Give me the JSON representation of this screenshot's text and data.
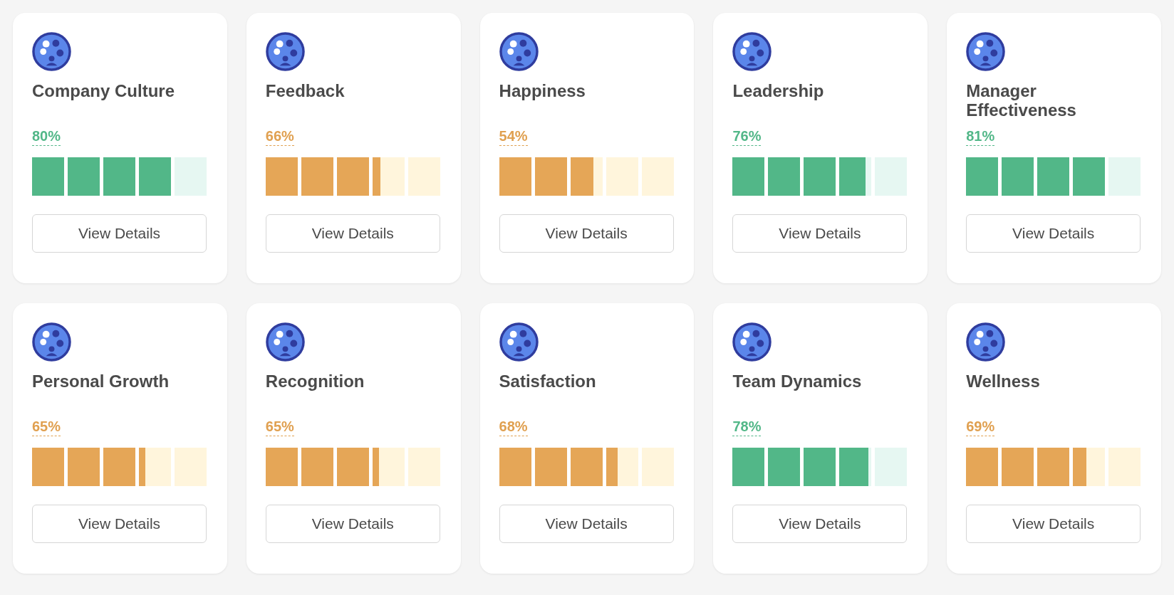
{
  "cards": [
    {
      "title": "Company Culture",
      "percent": "80%",
      "level": 0.8,
      "button": "View Details"
    },
    {
      "title": "Feedback",
      "percent": "66%",
      "level": 0.66,
      "button": "View Details"
    },
    {
      "title": "Happiness",
      "percent": "54%",
      "level": 0.54,
      "button": "View Details"
    },
    {
      "title": "Leadership",
      "percent": "76%",
      "level": 0.76,
      "button": "View Details"
    },
    {
      "title": "Manager Effectiveness",
      "percent": "81%",
      "level": 0.81,
      "button": "View Details"
    },
    {
      "title": "Personal Growth",
      "percent": "65%",
      "level": 0.65,
      "button": "View Details"
    },
    {
      "title": "Recognition",
      "percent": "65%",
      "level": 0.65,
      "button": "View Details"
    },
    {
      "title": "Satisfaction",
      "percent": "68%",
      "level": 0.68,
      "button": "View Details"
    },
    {
      "title": "Team Dynamics",
      "percent": "78%",
      "level": 0.78,
      "button": "View Details"
    },
    {
      "title": "Wellness",
      "percent": "69%",
      "level": 0.69,
      "button": "View Details"
    }
  ]
}
